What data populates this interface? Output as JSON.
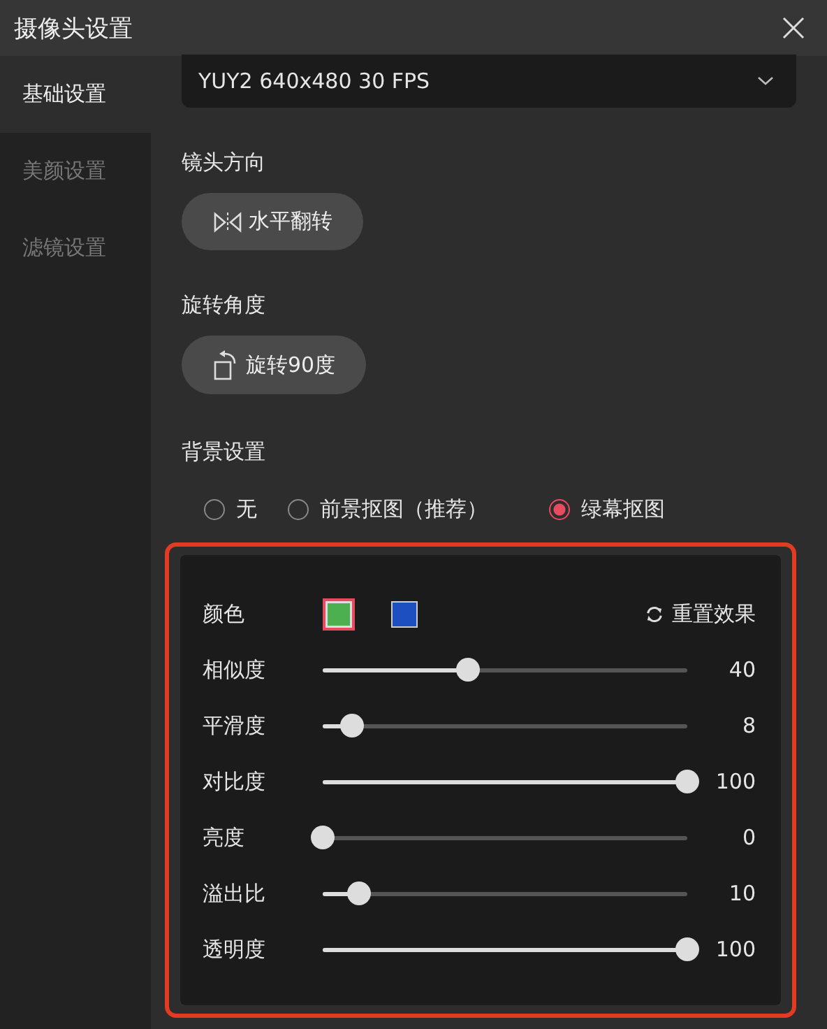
{
  "window": {
    "title": "摄像头设置"
  },
  "sidebar": {
    "items": [
      {
        "label": "基础设置",
        "selected": true
      },
      {
        "label": "美颜设置",
        "selected": false
      },
      {
        "label": "滤镜设置",
        "selected": false
      }
    ]
  },
  "format_dropdown": {
    "value": "YUY2 640x480 30 FPS"
  },
  "lens_direction": {
    "label": "镜头方向",
    "button": "水平翻转"
  },
  "rotation": {
    "label": "旋转角度",
    "button": "旋转90度"
  },
  "background": {
    "label": "背景设置",
    "options": [
      {
        "label": "无",
        "selected": false
      },
      {
        "label": "前景抠图（推荐）",
        "selected": false
      },
      {
        "label": "绿幕抠图",
        "selected": true
      }
    ]
  },
  "green_screen": {
    "color_label": "颜色",
    "colors": [
      {
        "color": "#4caf50",
        "selected": true
      },
      {
        "color": "#1e4fc0",
        "selected": false
      }
    ],
    "reset_button": "重置效果",
    "sliders": [
      {
        "name": "相似度",
        "level": 0.4,
        "reading": "40"
      },
      {
        "name": "平滑度",
        "level": 0.08,
        "reading": "8"
      },
      {
        "name": "对比度",
        "level": 1,
        "reading": "100"
      },
      {
        "name": "亮度",
        "level": 0,
        "reading": "0"
      },
      {
        "name": "溢出比",
        "level": 0.1,
        "reading": "10"
      },
      {
        "name": "透明度",
        "level": 1,
        "reading": "100"
      }
    ]
  }
}
